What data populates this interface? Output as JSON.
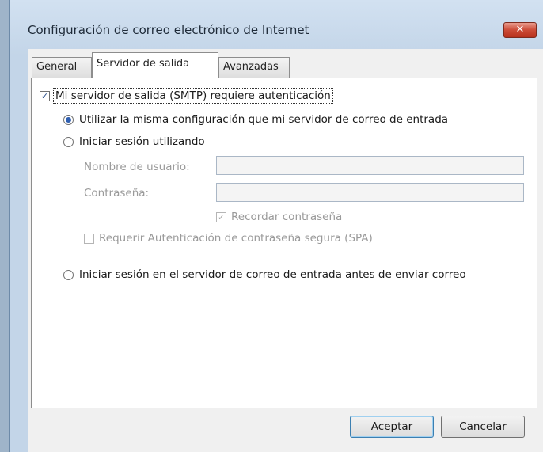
{
  "window": {
    "title": "Configuración de correo electrónico de Internet",
    "close_glyph": "✕"
  },
  "tabs": [
    {
      "label": "General",
      "active": false
    },
    {
      "label": "Servidor de salida",
      "active": true
    },
    {
      "label": "Avanzadas",
      "active": false
    }
  ],
  "smtp_auth": {
    "label": "Mi servidor de salida (SMTP) requiere autenticación",
    "checked": true
  },
  "options": {
    "same_settings": {
      "label": "Utilizar la misma configuración que mi servidor de correo de entrada",
      "selected": true
    },
    "login_using": {
      "label": "Iniciar sesión utilizando",
      "selected": false
    },
    "username": {
      "label": "Nombre de usuario:",
      "value": ""
    },
    "password": {
      "label": "Contraseña:",
      "value": ""
    },
    "remember_password": {
      "label": "Recordar contraseña",
      "checked": true
    },
    "spa": {
      "label": "Requerir Autenticación de contraseña segura (SPA)",
      "checked": false
    },
    "login_before_send": {
      "label": "Iniciar sesión en el servidor de correo de entrada antes de enviar correo",
      "selected": false
    }
  },
  "buttons": {
    "accept": "Aceptar",
    "cancel": "Cancelar"
  },
  "colors": {
    "accent": "#2f5fb1",
    "close": "#cc4b37"
  }
}
